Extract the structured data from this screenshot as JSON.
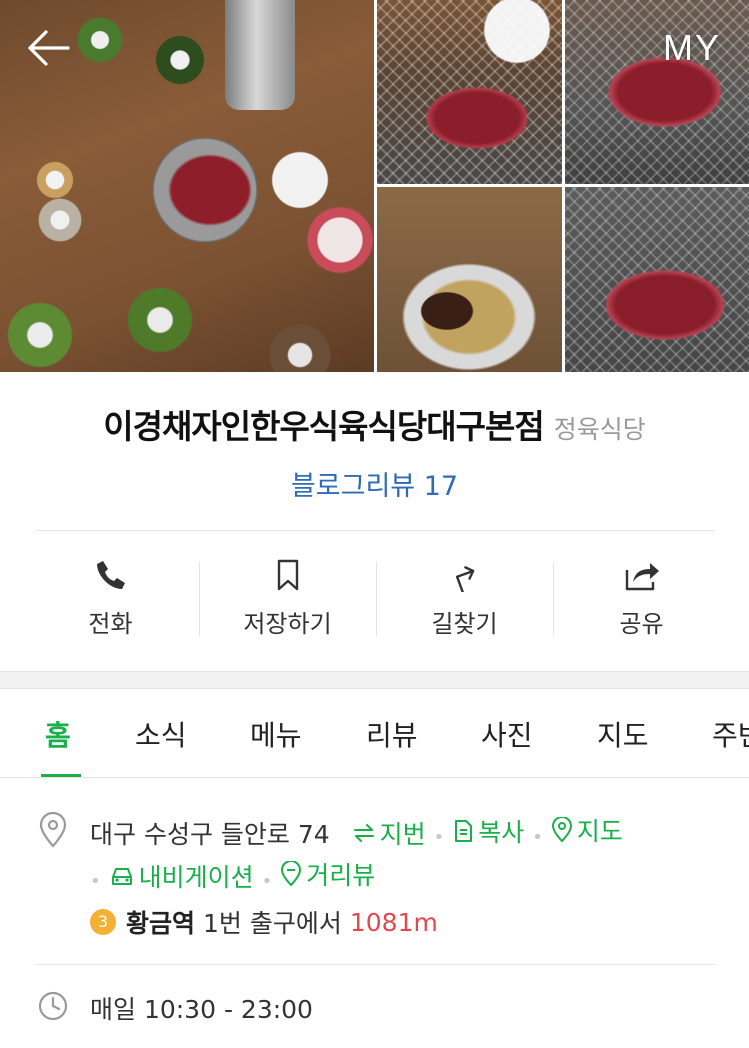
{
  "header": {
    "back_icon": "arrow-left-icon",
    "my_label": "MY",
    "photos": [
      "grill-table-photo",
      "beef-on-grill-photo",
      "marbled-beef-photo",
      "grilled-beef-tongs-photo",
      "beef-on-grill-photo-2"
    ]
  },
  "place": {
    "name": "이경채자인한우식육식당대구본점",
    "category": "정육식당",
    "blog_review": "블로그리뷰 17"
  },
  "actions": [
    {
      "label": "전화",
      "icon": "phone-icon"
    },
    {
      "label": "저장하기",
      "icon": "bookmark-icon"
    },
    {
      "label": "길찾기",
      "icon": "directions-icon"
    },
    {
      "label": "공유",
      "icon": "share-icon"
    }
  ],
  "tabs": [
    {
      "label": "홈",
      "active": true
    },
    {
      "label": "소식"
    },
    {
      "label": "메뉴"
    },
    {
      "label": "리뷰"
    },
    {
      "label": "사진"
    },
    {
      "label": "지도"
    },
    {
      "label": "주변"
    }
  ],
  "info": {
    "address": "대구 수성구 들안로 74",
    "jibun": "지번",
    "copy": "복사",
    "map": "지도",
    "navigation": "내비게이션",
    "street_view": "거리뷰",
    "subway_line": "3",
    "subway_line_color": "#f2b035",
    "station": "황금역",
    "exit_text": "1번 출구에서",
    "distance": "1081m",
    "hours": "매일 10:30 - 23:00"
  },
  "colors": {
    "accent": "#19b04b",
    "link_blue": "#2f6bb6",
    "distance_red": "#e0494e"
  }
}
